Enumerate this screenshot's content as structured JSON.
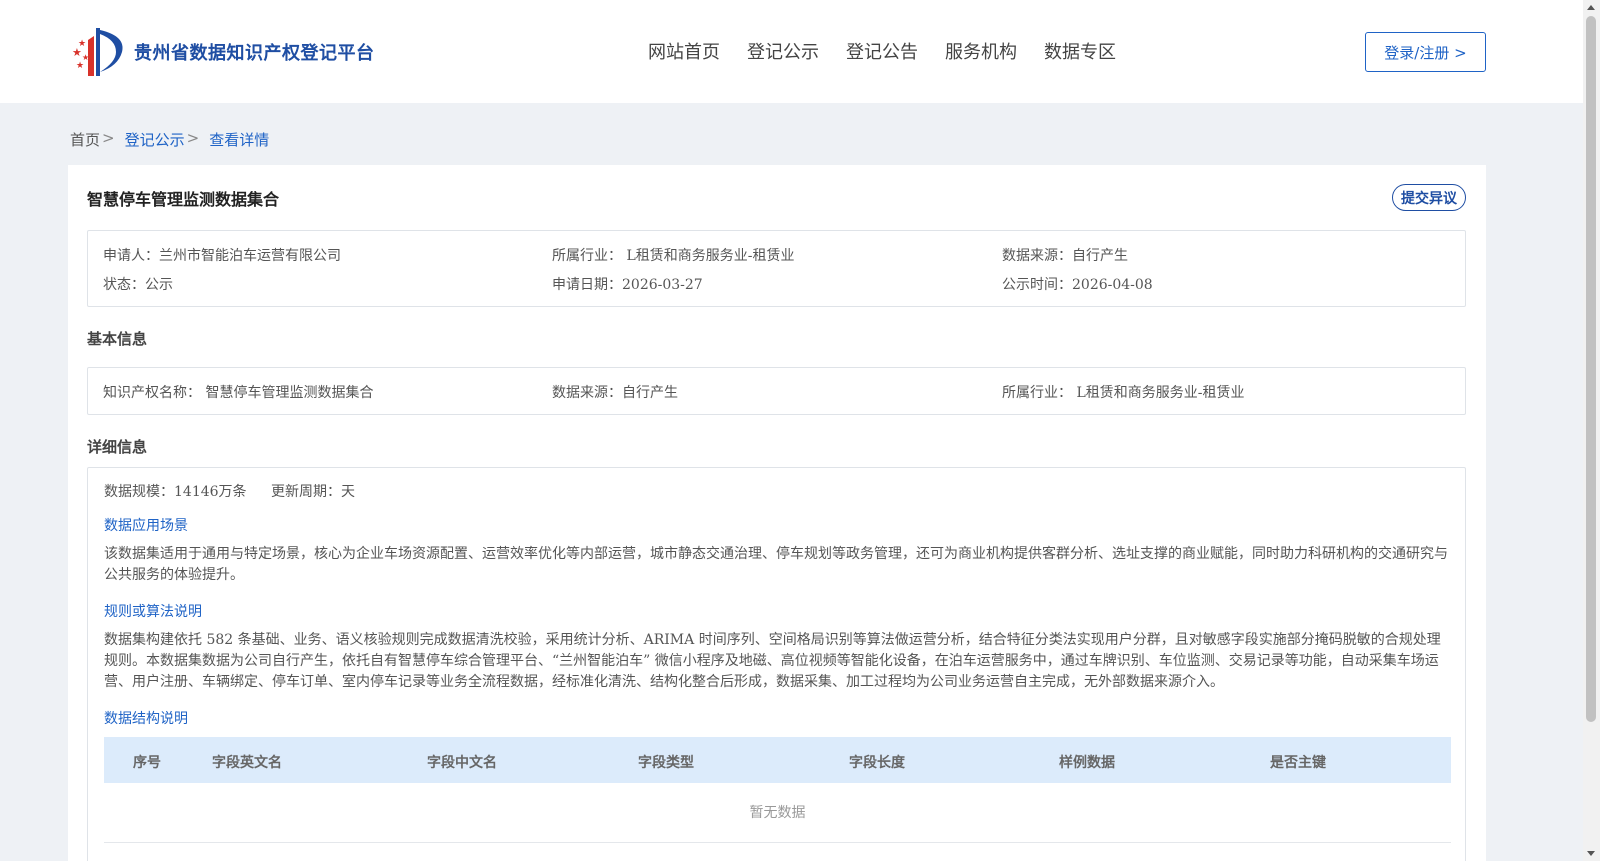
{
  "header": {
    "site_name": "贵州省数据知识产权登记平台",
    "nav": [
      "网站首页",
      "登记公示",
      "登记公告",
      "服务机构",
      "数据专区"
    ],
    "login_label": "登录/注册 >"
  },
  "breadcrumb": {
    "home": "首页",
    "section": "登记公示",
    "current": "查看详情",
    "sep": ">"
  },
  "record": {
    "title": "智慧停车管理监测数据集合",
    "objection_label": "提交异议",
    "summary": {
      "applicant": "申请人：兰州市智能泊车运营有限公司",
      "industry": "所属行业： L租赁和商务服务业-租赁业",
      "source": "数据来源：自行产生",
      "status": "状态：公示",
      "apply_date": "申请日期：2026-03-27",
      "publish_date": "公示时间：2026-04-08"
    }
  },
  "basic": {
    "section_title": "基本信息",
    "ip_name": "知识产权名称： 智慧停车管理监测数据集合",
    "source": "数据来源：自行产生",
    "industry": "所属行业： L租赁和商务服务业-租赁业"
  },
  "detail": {
    "section_title": "详细信息",
    "scale": "数据规模：14146万条",
    "update_cycle": "更新周期：天",
    "scenario_title": "数据应用场景",
    "scenario_text": "该数据集适用于通用与特定场景，核心为企业车场资源配置、运营效率优化等内部运营，城市静态交通治理、停车规划等政务管理，还可为商业机构提供客群分析、选址支撑的商业赋能，同时助力科研机构的交通研究与公共服务的体验提升。",
    "rules_title": "规则或算法说明",
    "rules_text": "数据集构建依托 582 条基础、业务、语义核验规则完成数据清洗校验，采用统计分析、ARIMA 时间序列、空间格局识别等算法做运营分析，结合特征分类法实现用户分群，且对敏感字段实施部分掩码脱敏的合规处理规则。本数据集数据为公司自行产生，依托自有智慧停车综合管理平台、“兰州智能泊车” 微信小程序及地磁、高位视频等智能化设备，在泊车运营服务中，通过车牌识别、车位监测、交易记录等功能，自动采集车场运营、用户注册、车辆绑定、停车订单、室内停车记录等业务全流程数据，经标准化清洗、结构化整合后形成，数据采集、加工过程均为公司业务运营自主完成，无外部数据来源介入。",
    "structure_title": "数据结构说明",
    "table_headers": [
      "序号",
      "字段英文名",
      "字段中文名",
      "字段类型",
      "字段长度",
      "样例数据",
      "是否主键"
    ],
    "empty_text": "暂无数据"
  }
}
